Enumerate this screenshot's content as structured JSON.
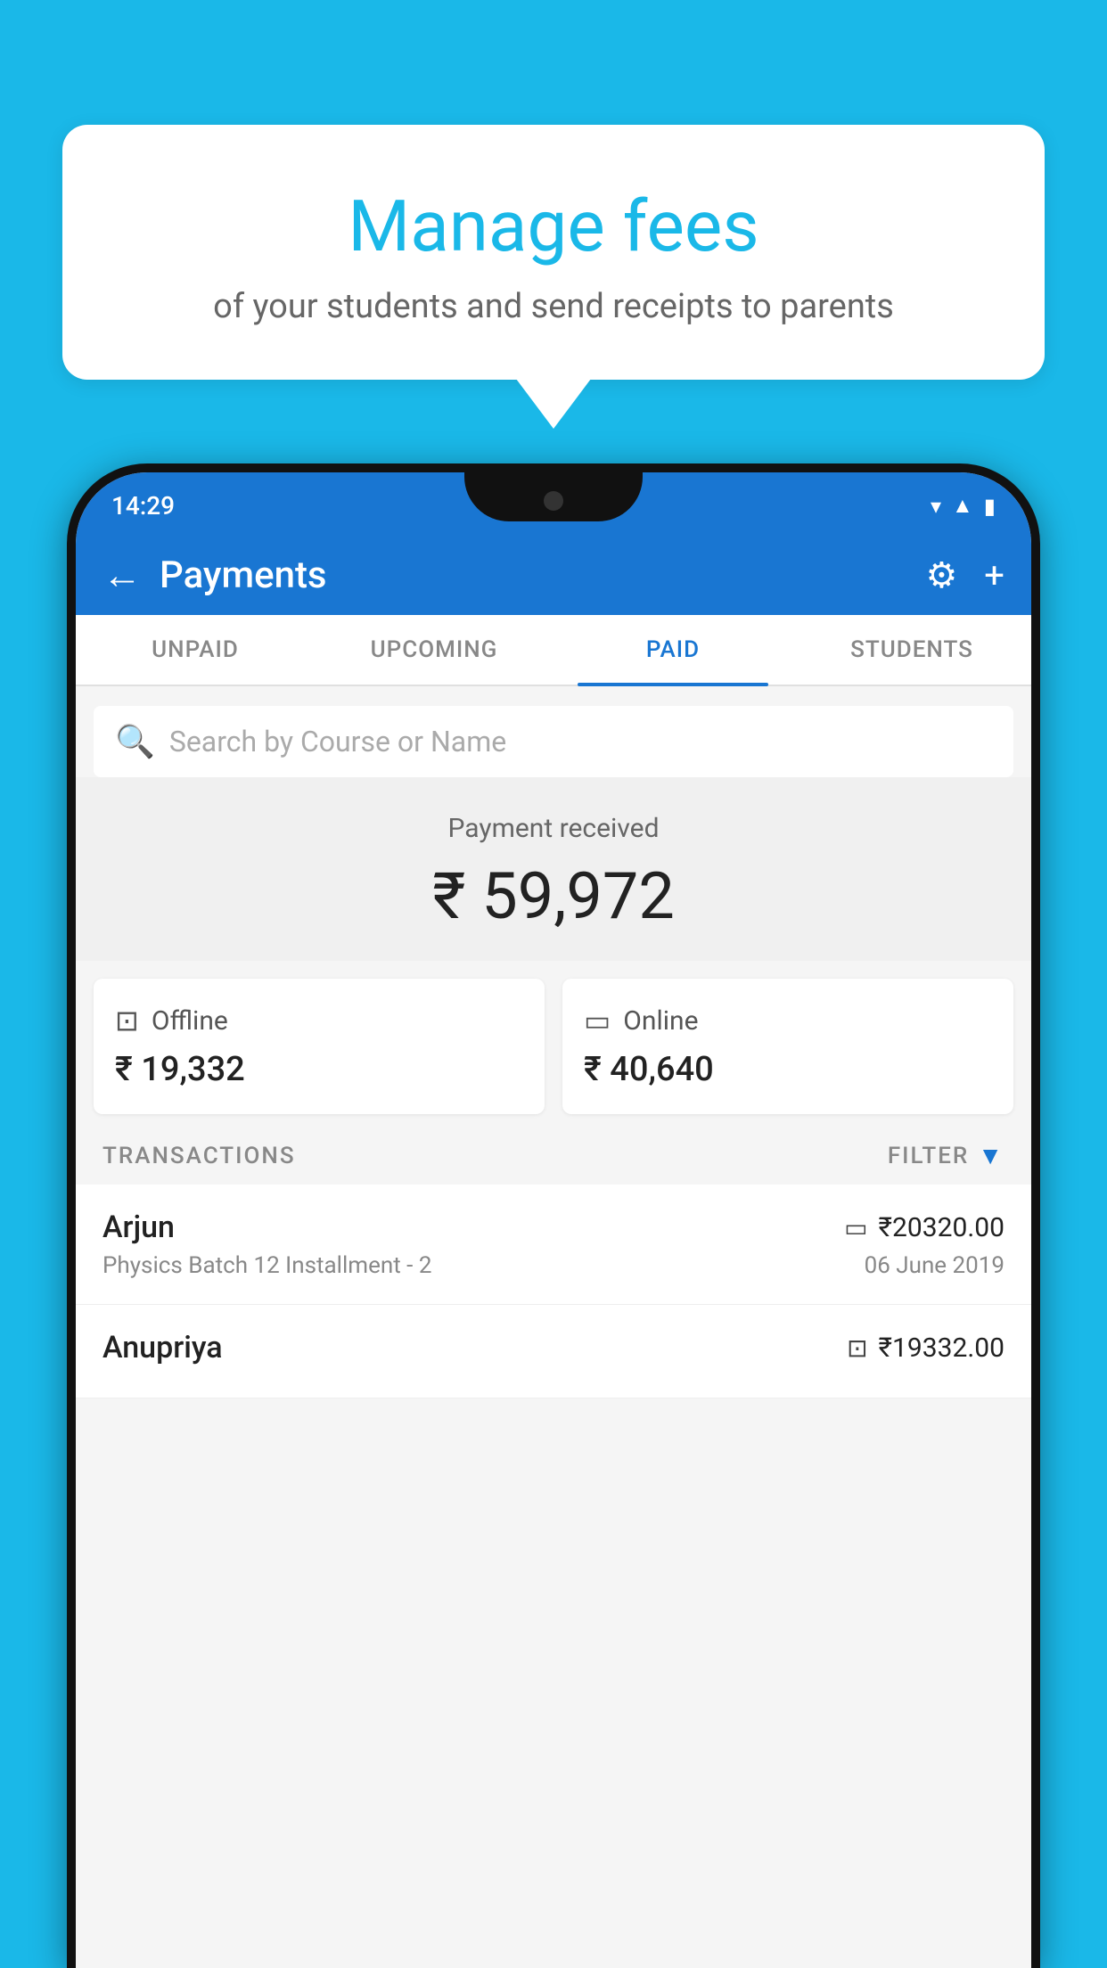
{
  "background_color": "#1ab8e8",
  "speech_bubble": {
    "title": "Manage fees",
    "subtitle": "of your students and send receipts to parents"
  },
  "status_bar": {
    "time": "14:29",
    "wifi_icon": "▾",
    "signal_icon": "▲",
    "battery_icon": "▮"
  },
  "header": {
    "back_label": "←",
    "title": "Payments",
    "settings_icon": "⚙",
    "add_icon": "+"
  },
  "tabs": [
    {
      "label": "UNPAID",
      "active": false
    },
    {
      "label": "UPCOMING",
      "active": false
    },
    {
      "label": "PAID",
      "active": true
    },
    {
      "label": "STUDENTS",
      "active": false
    }
  ],
  "search": {
    "placeholder": "Search by Course or Name"
  },
  "payment_summary": {
    "label": "Payment received",
    "amount": "₹ 59,972",
    "offline": {
      "type": "Offline",
      "amount": "₹ 19,332"
    },
    "online": {
      "type": "Online",
      "amount": "₹ 40,640"
    }
  },
  "transactions": {
    "section_label": "TRANSACTIONS",
    "filter_label": "FILTER",
    "rows": [
      {
        "name": "Arjun",
        "description": "Physics Batch 12 Installment - 2",
        "amount": "₹20320.00",
        "date": "06 June 2019",
        "payment_type": "online"
      },
      {
        "name": "Anupriya",
        "description": "",
        "amount": "₹19332.00",
        "date": "",
        "payment_type": "offline"
      }
    ]
  }
}
